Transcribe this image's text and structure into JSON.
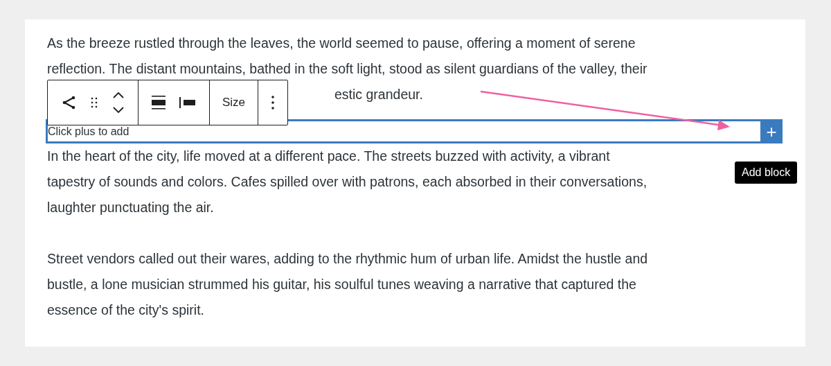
{
  "paragraphs": [
    {
      "lines": [
        "As the breeze rustled through the leaves, the world seemed to pause, offering a moment of serene",
        "reflection. The distant mountains, bathed in the soft light, stood as silent guardians of the valley, their"
      ],
      "tail": "estic grandeur."
    },
    {
      "lines": [
        "In the heart of the city, life moved at a different pace. The streets buzzed with activity, a vibrant",
        "tapestry of sounds and colors. Cafes spilled over with patrons, each absorbed in their conversations,",
        "laughter punctuating the air."
      ]
    },
    {
      "lines": [
        "Street vendors called out their wares, adding to the rhythmic hum of urban life. Amidst the hustle and",
        "bustle, a lone musician strummed his guitar, his soulful tunes weaving a narrative that captured the",
        "essence of the city's spirit."
      ]
    }
  ],
  "toolbar": {
    "size_label": "Size"
  },
  "inserter": {
    "placeholder": "Click plus to add",
    "add_label": "+",
    "tooltip": "Add block"
  }
}
